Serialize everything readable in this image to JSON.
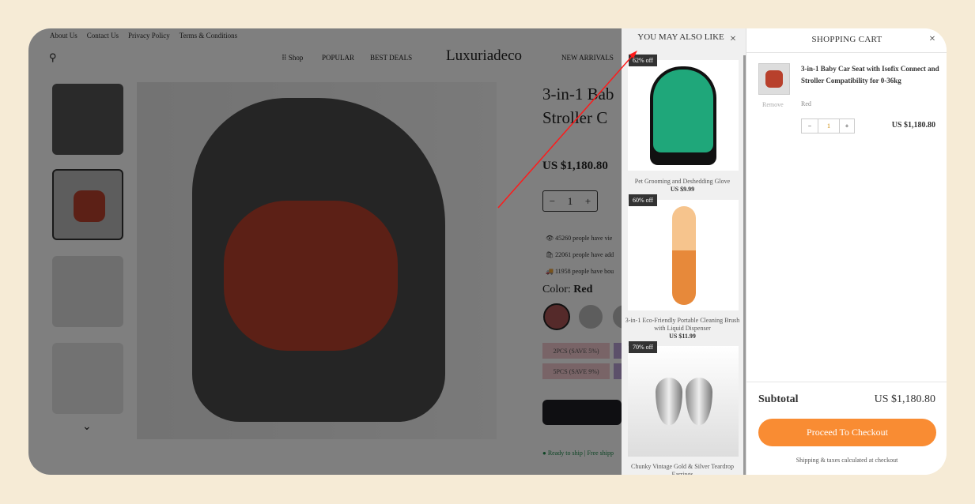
{
  "top_links": [
    "About Us",
    "Contact Us",
    "Privacy Policy",
    "Terms & Conditions"
  ],
  "nav": {
    "shop": "Shop",
    "popular": "POPULAR",
    "best_deals": "BEST DEALS",
    "logo": "Luxuriadeco",
    "new_arrivals": "NEW ARRIVALS"
  },
  "product": {
    "title_line1": "3-in-1 Bab",
    "title_line2": "Stroller C",
    "price": "US $1,180.80",
    "qty": "1",
    "stats": [
      "45260 people have vie",
      "22061 people have add",
      "11958 people have bou"
    ],
    "color_label": "Color:",
    "color_value": "Red",
    "packs": [
      "2PCS (SAVE 5%)",
      "5PCS (SAVE 9%)"
    ],
    "ship": "Ready to ship | Free shipp"
  },
  "recommend": {
    "title": "YOU MAY ALSO LIKE",
    "items": [
      {
        "badge": "62% off",
        "name": "Pet Grooming and Deshedding Glove",
        "price": "US $9.99"
      },
      {
        "badge": "60% off",
        "name": "3-in-1 Eco-Friendly Portable Cleaning Brush with Liquid Dispenser",
        "price": "US $11.99"
      },
      {
        "badge": "70% off",
        "name": "Chunky Vintage Gold & Silver Teardrop Earrings",
        "price": ""
      }
    ]
  },
  "cart": {
    "title": "SHOPPING CART",
    "item_name": "3-in-1 Baby Car Seat with Isofix Connect and Stroller Compatibility for 0-36kg",
    "remove": "Remove",
    "variant": "Red",
    "qty": "1",
    "minus": "−",
    "plus": "+",
    "item_price": "US $1,180.80",
    "subtotal_label": "Subtotal",
    "subtotal": "US $1,180.80",
    "checkout": "Proceed To Checkout",
    "note": "Shipping & taxes calculated at checkout"
  },
  "colors": {
    "accent": "#f98c33",
    "annotation": "#ff0000",
    "background": "#f6ebd6"
  }
}
